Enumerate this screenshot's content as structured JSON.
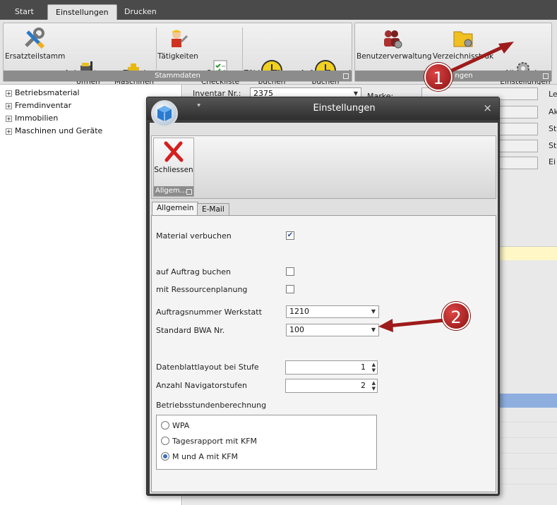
{
  "ribbon_tabs": [
    "Start",
    "Einstellungen",
    "Drucken"
  ],
  "ribbon": {
    "group1": {
      "label": "Stammdaten",
      "buttons": [
        {
          "label": "Ersatzteilstamm",
          "icon": "wrench-screwdriver-icon"
        },
        {
          "label": "Anlagestamm\nöffnen",
          "icon": "forklift-icon"
        },
        {
          "label": "Fremd\nMaschinen",
          "icon": "bulldozer-icon"
        },
        {
          "label": "Tätigkeiten",
          "icon": "worker-icon"
        },
        {
          "label": "Service\nCheckliste",
          "icon": "checklist-icon"
        },
        {
          "label": "Zählerdifferenz\nbuchen",
          "icon": "clock-icon"
        },
        {
          "label": "Anfangsstand\nbuchen",
          "icon": "clock-icon"
        }
      ]
    },
    "group2": {
      "label": "ngen",
      "buttons": [
        {
          "label": "Benutzerverwaltung",
          "icon": "users-gear-icon"
        },
        {
          "label": "Verzeichnisstruk",
          "icon": "folder-gear-icon"
        },
        {
          "label": "Allgemeine\nEinstellungen",
          "icon": "gears-icon"
        }
      ]
    }
  },
  "tree": [
    "Betriebsmaterial",
    "Fremdinventar",
    "Immobilien",
    "Maschinen und Geräte"
  ],
  "background_form": {
    "inventar_label": "Inventar Nr.:",
    "inventar_value": "2375",
    "marke_label": "Marke:",
    "right_labels": [
      "Le",
      "Ak",
      "St",
      "St",
      "Ei"
    ]
  },
  "dialog": {
    "title": "Einstellungen",
    "close_glyph": "×",
    "close_button_label": "Schliessen",
    "group_label": "Allgem...",
    "tabs": [
      "Allgemein",
      "E-Mail"
    ],
    "fields": {
      "material_verbuchen": {
        "label": "Material verbuchen",
        "checked": true
      },
      "auf_auftrag_buchen": {
        "label": "auf Auftrag buchen",
        "checked": false
      },
      "mit_ressourcenplanung": {
        "label": "mit Ressourcenplanung",
        "checked": false
      },
      "auftragsnummer": {
        "label": "Auftragsnummer Werkstatt",
        "value": "1210"
      },
      "standard_bwa": {
        "label": "Standard BWA Nr.",
        "value": "100"
      },
      "datenblattlayout": {
        "label": "Datenblattlayout bei Stufe",
        "value": "1"
      },
      "navigatorstufen": {
        "label": "Anzahl Navigatorstufen",
        "value": "2"
      }
    },
    "betriebsstunden": {
      "label": "Betriebsstundenberechnung",
      "options": [
        "WPA",
        "Tagesrapport mit KFM",
        "M und A mit KFM"
      ],
      "selected": 2
    }
  },
  "callouts": [
    "1",
    "2"
  ],
  "colors": {
    "callout": "#b01c1c",
    "arrow": "#9e1b1b",
    "selection_blue": "#8faee0",
    "highlight_yellow": "#fff8c6"
  }
}
